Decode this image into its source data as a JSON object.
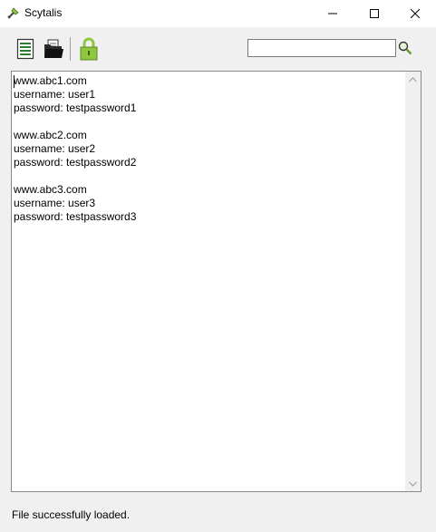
{
  "window": {
    "title": "Scytalis"
  },
  "toolbar": {
    "new_icon": "new-document-icon",
    "open_icon": "open-folder-icon",
    "lock_icon": "lock-icon",
    "search": {
      "value": "",
      "placeholder": ""
    },
    "search_icon": "search-icon"
  },
  "editor": {
    "content": "www.abc1.com\nusername: user1\npassword: testpassword1\n\nwww.abc2.com\nusername: user2\npassword: testpassword2\n\nwww.abc3.com\nusername: user3\npassword: testpassword3"
  },
  "status": {
    "text": "File successfully loaded."
  },
  "colors": {
    "lock_green": "#8dc63f",
    "document_green": "#2e7d32",
    "folder_dark": "#2b2b2b"
  }
}
